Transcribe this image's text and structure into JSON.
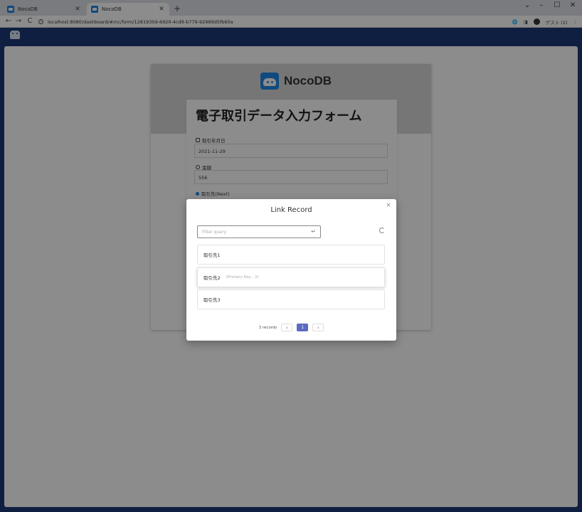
{
  "browser": {
    "tabs": [
      {
        "title": "NocoDB",
        "active": false
      },
      {
        "title": "NocoDB",
        "active": true
      }
    ],
    "url": "localhost:8080/dashboard/#/nc/form/1281930d-6920-4cd9-b779-92989d5fb60a",
    "profile_label": "ゲスト (2)",
    "new_tab": "+",
    "close_glyph": "✕",
    "window_controls": {
      "chevron": "⌄",
      "minimize": "–",
      "maximize": "☐",
      "close": "✕"
    },
    "nav": {
      "back": "←",
      "forward": "→",
      "reload": "C"
    },
    "menu_glyph": "⋮"
  },
  "form": {
    "brand": "NocoDB",
    "title": "電子取引データ入力フォーム",
    "fields": [
      {
        "label": "取引年月日",
        "value": "2021-11-29"
      },
      {
        "label": "金額",
        "value": "556"
      },
      {
        "label": "取引先(Next)",
        "value": ""
      }
    ]
  },
  "modal": {
    "title": "Link Record",
    "close": "×",
    "filter_placeholder": "Filter query",
    "filter_value": "",
    "enter_glyph": "↵",
    "records": [
      {
        "label": "取引先1",
        "pk": ""
      },
      {
        "label": "取引先2",
        "pk": "(Primary Key : 2)"
      },
      {
        "label": "取引先3",
        "pk": ""
      }
    ],
    "pagination": {
      "count_label": "3 records",
      "current_page": "1",
      "prev": "‹",
      "next": "›"
    }
  },
  "colors": {
    "header": "#1c3a78",
    "accent": "#5c6bc0",
    "brand_blue": "#1e88e5"
  }
}
